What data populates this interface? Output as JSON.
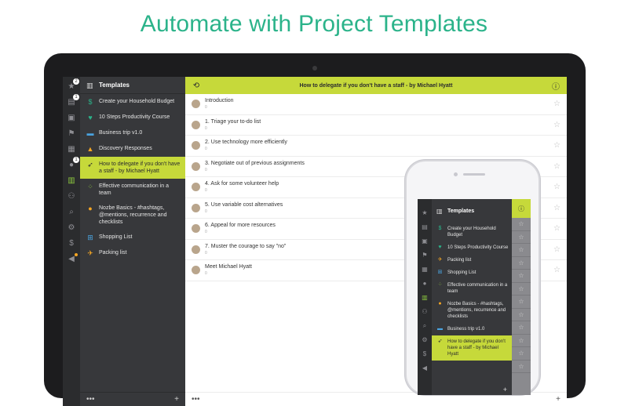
{
  "headline": "Automate with Project Templates",
  "colors": {
    "accent": "#c6d93a",
    "headline": "#2bb38a",
    "sidebar": "#37383b",
    "rail": "#2b2c2e"
  },
  "rail": {
    "icons": [
      "priority-icon",
      "inbox-icon",
      "briefcase-icon",
      "flag-icon",
      "calendar-icon",
      "comments-icon",
      "templates-icon",
      "team-icon",
      "search-icon",
      "settings-icon",
      "dollar-icon",
      "megaphone-icon"
    ],
    "badges": {
      "priority": "2",
      "inbox": "1",
      "comments": "1"
    }
  },
  "sidebar": {
    "title": "Templates",
    "items": [
      {
        "label": "Create your Household Budget",
        "icon": "dollar-icon",
        "color": "#2bb38a"
      },
      {
        "label": "10 Steps Productivity Course",
        "icon": "heart-icon",
        "color": "#2bb38a"
      },
      {
        "label": "Business trip v1.0",
        "icon": "bus-icon",
        "color": "#4aa3df"
      },
      {
        "label": "Discovery Responses",
        "icon": "thumbs-up-icon",
        "color": "#f5a623"
      },
      {
        "label": "How to delegate if you don't have a staff - by Michael Hyatt",
        "icon": "rocket-icon",
        "color": "#2b2c2e"
      },
      {
        "label": "Effective communication in a team",
        "icon": "people-icon",
        "color": "#8cc63f"
      },
      {
        "label": "Nozbe Basics - #hashtags, @mentions, recurrence and checklists",
        "icon": "bulb-icon",
        "color": "#f5a623"
      },
      {
        "label": "Shopping List",
        "icon": "cart-icon",
        "color": "#4aa3df"
      },
      {
        "label": "Packing list",
        "icon": "plane-icon",
        "color": "#f5a623"
      }
    ],
    "footer_more": "•••",
    "footer_add": "+"
  },
  "main": {
    "title": "How to delegate if you don't have a staff - by Michael Hyatt",
    "tasks": [
      {
        "name": "Introduction",
        "comments": "0"
      },
      {
        "name": "1. Triage your to-do list",
        "comments": "0"
      },
      {
        "name": "2. Use technology more efficiently",
        "comments": "0"
      },
      {
        "name": "3. Negotiate out of previous assignments",
        "comments": "0"
      },
      {
        "name": "4. Ask for some volunteer help",
        "comments": "0"
      },
      {
        "name": "5. Use variable cost alternatives",
        "comments": "0"
      },
      {
        "name": "6. Appeal for more resources",
        "comments": "0"
      },
      {
        "name": "7. Muster the courage to say \"no\"",
        "comments": "0"
      },
      {
        "name": "Meet Michael Hyatt",
        "comments": "0"
      }
    ],
    "footer_more": "•••",
    "footer_add": "+"
  },
  "phone": {
    "title": "Templates",
    "items": [
      {
        "label": "Create your Household Budget",
        "color": "#2bb38a"
      },
      {
        "label": "10 Steps Productivity Course",
        "color": "#2bb38a"
      },
      {
        "label": "Packing list",
        "color": "#f5a623"
      },
      {
        "label": "Shopping List",
        "color": "#4aa3df"
      },
      {
        "label": "Effective communication in a team",
        "color": "#8cc63f"
      },
      {
        "label": "Nozbe Basics - #hashtags, @mentions, recurrence and checklists",
        "color": "#f5a623"
      },
      {
        "label": "Business trip v1.0",
        "color": "#4aa3df"
      },
      {
        "label": "How to delegate if you don't have a staff - by Michael Hyatt",
        "color": "#2b2c2e"
      }
    ],
    "footer_add": "+"
  }
}
